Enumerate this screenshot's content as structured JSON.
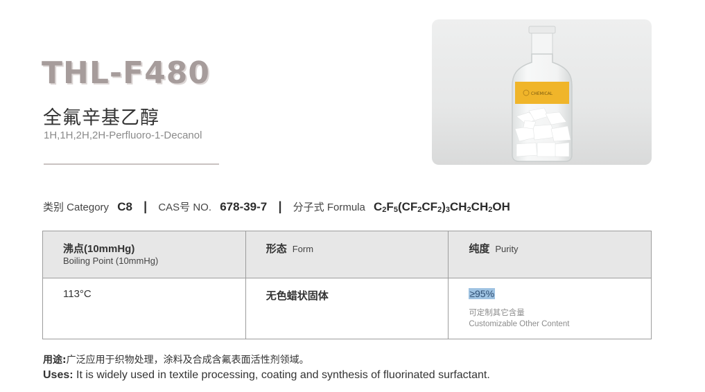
{
  "product": {
    "model": "THL-F480",
    "name_cn": "全氟辛基乙醇",
    "name_en": "1H,1H,2H,2H-Perfluoro-1-Decanol",
    "label_text": "CHEMICAL"
  },
  "specline": {
    "category_label": "类别 Category",
    "category_value": "C8",
    "cas_label": "CAS号 NO.",
    "cas_value": "678-39-7",
    "formula_label": "分子式 Formula",
    "formula_parts": [
      "C",
      "2",
      "F",
      "5",
      "(CF",
      "2",
      "CF",
      "2",
      ")",
      "3",
      "CH",
      "2",
      "CH",
      "2",
      "OH"
    ]
  },
  "table": {
    "headers": [
      {
        "main": "沸点(10mmHg)",
        "sub": "Boiling Point (10mmHg)"
      },
      {
        "main": "形态",
        "en": "Form"
      },
      {
        "main": "纯度",
        "en": "Purity"
      }
    ],
    "row": {
      "boiling_point": "113°C",
      "form": "无色蜡状固体",
      "purity": "≥95%",
      "note_cn": "可定制其它含量",
      "note_en": "Customizable Other Content"
    }
  },
  "uses": {
    "cn_label": "用途:",
    "cn_text": "广泛应用于织物处理，涂料及合成含氟表面活性剂领域。",
    "en_label": "Uses:",
    "en_text": " It is widely used in textile processing, coating and synthesis of fluorinated surfactant."
  },
  "colors": {
    "model_text": "#a69c9b",
    "purity_highlight": "#9fc3e2",
    "label_yellow": "#f0b52a"
  }
}
